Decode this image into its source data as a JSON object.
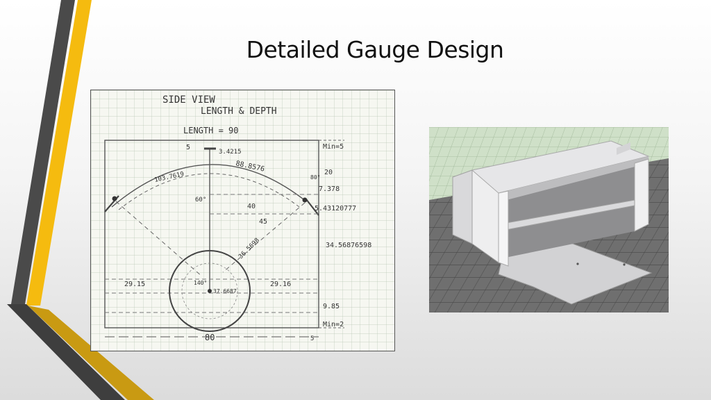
{
  "slide": {
    "title": "Detailed Gauge Design"
  },
  "sketch": {
    "heading": "SIDE VIEW",
    "subheading": "LENGTH & DEPTH",
    "length_note": "LENGTH = 90",
    "labels": {
      "top_5": "5",
      "dim_3_4215": "3.4215",
      "dim_88_8576": "88.8576",
      "dim_103_7619": "103.7619",
      "min_5": "Min=5",
      "dim_20": "20",
      "dim_7_378": "7.378",
      "dim_5_43": "5.43120777",
      "deg_60": "60°",
      "deg_80": "80°",
      "dim_40": "40",
      "dim_45": "45",
      "dim_36_5698": "36.5698",
      "dim_34_568": "34.56876598",
      "dim_29_15": "29.15",
      "dim_29_16": "29.16",
      "dim_140": "140°",
      "dim_37_6687": "37.6687",
      "dim_9_85": "9.85",
      "min_2": "Min=2",
      "bottom_80": "80",
      "bottom_5": "5"
    }
  },
  "render": {
    "colors": {
      "floor": "#6f6f6f",
      "grid": "#4a4a4a",
      "backdrop": "#cfe0c8",
      "part": "#e4e4e6"
    }
  }
}
